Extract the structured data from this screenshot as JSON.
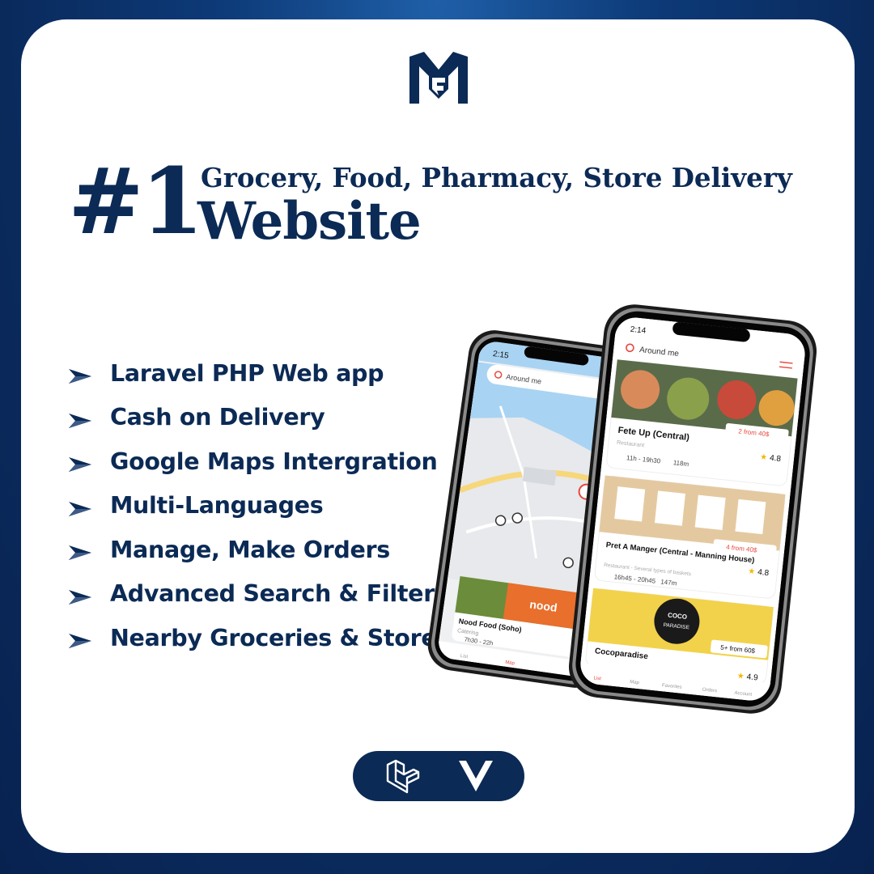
{
  "headline": {
    "rank": "#1",
    "subtitle": "Grocery, Food, Pharmacy, Store Delivery",
    "title": "Website"
  },
  "features": [
    "Laravel PHP Web app",
    "Cash on Delivery",
    "Google Maps Intergration",
    "Multi-Languages",
    "Manage, Make Orders",
    "Advanced Search & Filters",
    "Nearby Groceries & Stores"
  ],
  "phone_left": {
    "time": "2:15",
    "search_placeholder": "Around me",
    "card_title": "Nood Food (Soho)",
    "card_category": "Catering",
    "card_hours": "7h30 - 22h",
    "nav": [
      "List",
      "Map"
    ]
  },
  "phone_right": {
    "time": "2:14",
    "search_placeholder": "Around me",
    "restaurants": [
      {
        "name": "Fete Up (Central)",
        "category": "Restaurant",
        "hours": "11h - 19h30",
        "distance": "118m",
        "price": "2 from 40$",
        "rating": "4.8"
      },
      {
        "name": "Pret A Manger (Central - Manning House)",
        "category": "Restaurant - Several types of baskets",
        "hours": "16h45 - 20h45",
        "distance": "147m",
        "price": "4 from 40$",
        "rating": "4.8"
      },
      {
        "name": "Cocoparadise",
        "category": "",
        "hours": "",
        "distance": "",
        "price": "5+ from 60$",
        "rating": "4.9"
      }
    ],
    "badge_text": [
      "COCO",
      "PARADISE"
    ],
    "nav": [
      "List",
      "Map",
      "Favorites",
      "Orders",
      "Account"
    ]
  },
  "colors": {
    "navy": "#0b2a55",
    "accent_red": "#e8473e",
    "background_blue": "#0d3a78"
  },
  "tech_icons": [
    "laravel-icon",
    "vue-icon"
  ]
}
